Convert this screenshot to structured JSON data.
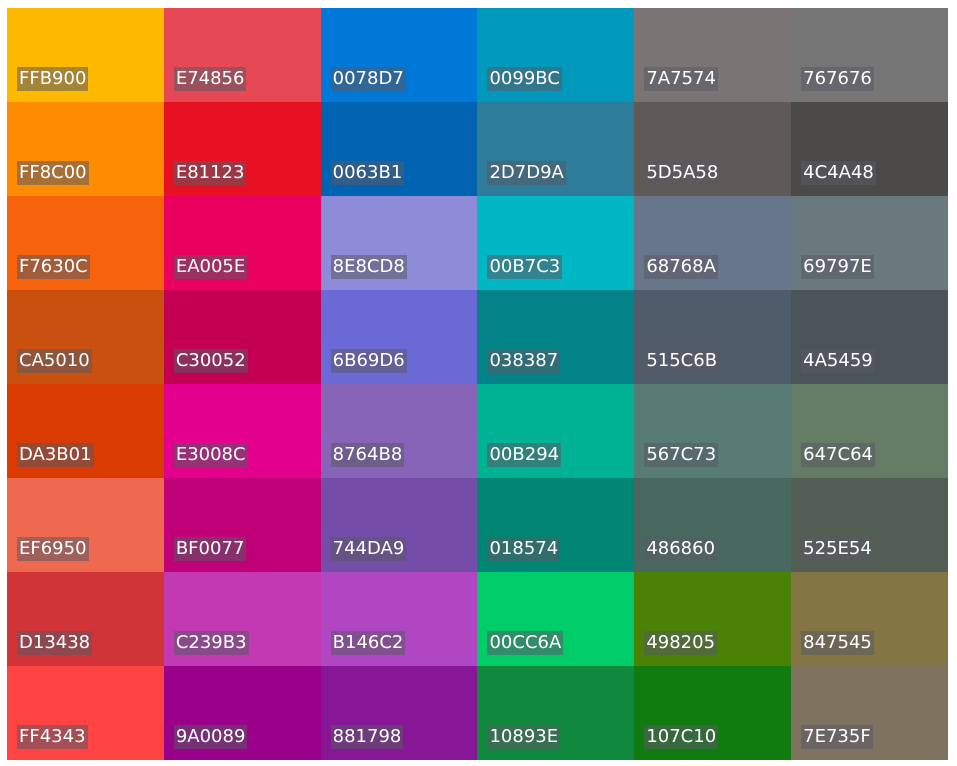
{
  "swatches": [
    {
      "hex": "FFB900",
      "color": "#FFB900"
    },
    {
      "hex": "E74856",
      "color": "#E74856"
    },
    {
      "hex": "0078D7",
      "color": "#0078D7"
    },
    {
      "hex": "0099BC",
      "color": "#0099BC"
    },
    {
      "hex": "7A7574",
      "color": "#7A7574"
    },
    {
      "hex": "767676",
      "color": "#767676"
    },
    {
      "hex": "FF8C00",
      "color": "#FF8C00"
    },
    {
      "hex": "E81123",
      "color": "#E81123"
    },
    {
      "hex": "0063B1",
      "color": "#0063B1"
    },
    {
      "hex": "2D7D9A",
      "color": "#2D7D9A"
    },
    {
      "hex": "5D5A58",
      "color": "#5D5A58"
    },
    {
      "hex": "4C4A48",
      "color": "#4C4A48"
    },
    {
      "hex": "F7630C",
      "color": "#F7630C"
    },
    {
      "hex": "EA005E",
      "color": "#EA005E"
    },
    {
      "hex": "8E8CD8",
      "color": "#8E8CD8"
    },
    {
      "hex": "00B7C3",
      "color": "#00B7C3"
    },
    {
      "hex": "68768A",
      "color": "#68768A"
    },
    {
      "hex": "69797E",
      "color": "#69797E"
    },
    {
      "hex": "CA5010",
      "color": "#CA5010"
    },
    {
      "hex": "C30052",
      "color": "#C30052"
    },
    {
      "hex": "6B69D6",
      "color": "#6B69D6"
    },
    {
      "hex": "038387",
      "color": "#038387"
    },
    {
      "hex": "515C6B",
      "color": "#515C6B"
    },
    {
      "hex": "4A5459",
      "color": "#4A5459"
    },
    {
      "hex": "DA3B01",
      "color": "#DA3B01"
    },
    {
      "hex": "E3008C",
      "color": "#E3008C"
    },
    {
      "hex": "8764B8",
      "color": "#8764B8"
    },
    {
      "hex": "00B294",
      "color": "#00B294"
    },
    {
      "hex": "567C73",
      "color": "#567C73"
    },
    {
      "hex": "647C64",
      "color": "#647C64"
    },
    {
      "hex": "EF6950",
      "color": "#EF6950"
    },
    {
      "hex": "BF0077",
      "color": "#BF0077"
    },
    {
      "hex": "744DA9",
      "color": "#744DA9"
    },
    {
      "hex": "018574",
      "color": "#018574"
    },
    {
      "hex": "486860",
      "color": "#486860"
    },
    {
      "hex": "525E54",
      "color": "#525E54"
    },
    {
      "hex": "D13438",
      "color": "#D13438"
    },
    {
      "hex": "C239B3",
      "color": "#C239B3"
    },
    {
      "hex": "B146C2",
      "color": "#B146C2"
    },
    {
      "hex": "00CC6A",
      "color": "#00CC6A"
    },
    {
      "hex": "498205",
      "color": "#498205"
    },
    {
      "hex": "847545",
      "color": "#847545"
    },
    {
      "hex": "FF4343",
      "color": "#FF4343"
    },
    {
      "hex": "9A0089",
      "color": "#9A0089"
    },
    {
      "hex": "881798",
      "color": "#881798"
    },
    {
      "hex": "10893E",
      "color": "#10893E"
    },
    {
      "hex": "107C10",
      "color": "#107C10"
    },
    {
      "hex": "7E735F",
      "color": "#7E735F"
    }
  ]
}
